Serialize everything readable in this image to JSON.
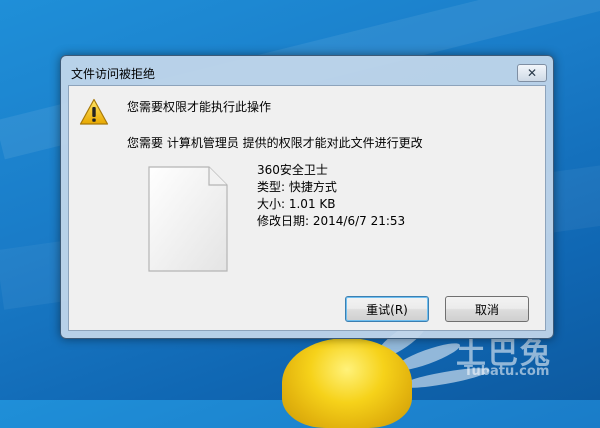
{
  "dialog": {
    "title": "文件访问被拒绝",
    "close_glyph": "✕",
    "heading": "您需要权限才能执行此操作",
    "message": "您需要 计算机管理员 提供的权限才能对此文件进行更改",
    "file": {
      "name": "360安全卫士",
      "type": "类型: 快捷方式",
      "size": "大小: 1.01 KB",
      "modified": "修改日期: 2014/6/7 21:53"
    },
    "buttons": {
      "retry": "重试(R)",
      "cancel": "取消"
    },
    "icons": {
      "warning": "warning-icon",
      "file": "file-icon",
      "close": "close-icon"
    }
  },
  "watermark": {
    "brand": "土巴兔",
    "url": "Tubatu.com"
  },
  "colors": {
    "desktop_blue": "#1a7cc8",
    "warning_yellow": "#f5c000",
    "dialog_frame": "#c4d7eb"
  }
}
